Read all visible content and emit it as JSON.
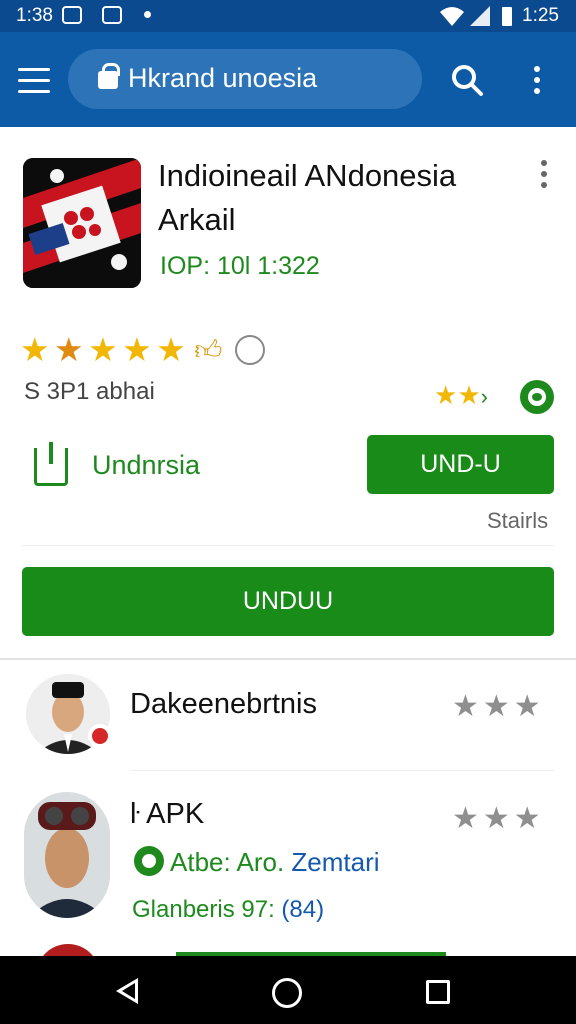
{
  "status_bar": {
    "time_left": "1:38",
    "time_right": "1:25",
    "icons": [
      "picture-in-picture-icon",
      "notification-icon",
      "dot-icon",
      "wifi-icon",
      "signal-icon",
      "battery-icon"
    ]
  },
  "app_bar": {
    "url_text": "Hkrand unoesia",
    "icons": [
      "menu-icon",
      "lock-icon",
      "search-icon",
      "more-vert-icon"
    ],
    "colors": {
      "bar": "#0d5aa7",
      "status": "#0b4a8f",
      "url_pill": "#2c73b8"
    }
  },
  "app": {
    "title": "Indioineail ANdonesia Arkail",
    "meta": "IOP: 10l  1:322",
    "icons": [
      "app-logo-icon",
      "more-vert-icon"
    ]
  },
  "rating": {
    "stars": 5,
    "subtitle": "S 3P1 abhai",
    "small_stars": 2.5,
    "icons": [
      "thumbs-up-icon",
      "badge-icon",
      "whatsapp-icon"
    ]
  },
  "download": {
    "link_label": "Undnrsia",
    "button_label": "UND-U",
    "status": "Stairls",
    "wide_button_label": "UNDUU",
    "colors": {
      "green": "#188b18"
    }
  },
  "list": {
    "items": [
      {
        "title": "Dakeenebrtnis",
        "stars": 3
      },
      {
        "title": "ŀ APK",
        "stars": 3,
        "line1_label": "Atbe: Aro.",
        "line1_value": "Zemtari",
        "line2_label": "Glanberis 97:",
        "line2_value": "(84)"
      }
    ]
  },
  "nav_bar": {
    "icons": [
      "back-icon",
      "home-icon",
      "recents-icon"
    ]
  }
}
